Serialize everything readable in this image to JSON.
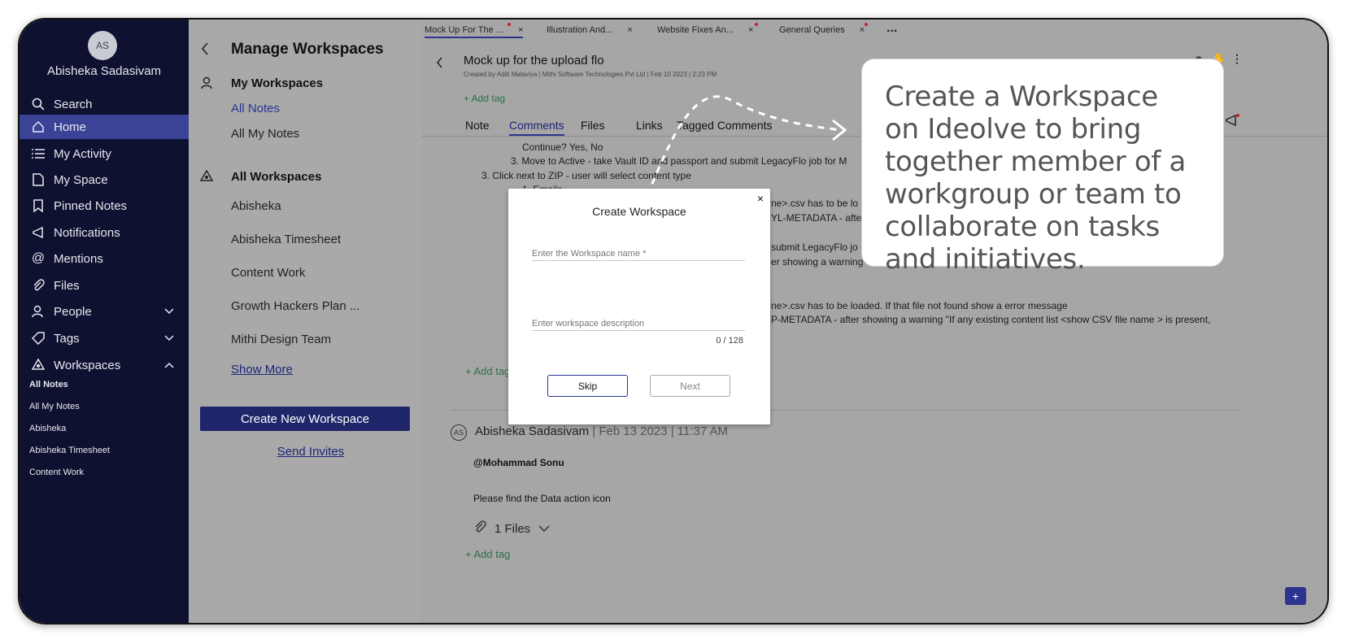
{
  "user": {
    "initials": "AS",
    "name": "Abisheka Sadasivam"
  },
  "nav": {
    "items": [
      {
        "label": "Search",
        "icon": "search-icon"
      },
      {
        "label": "Home",
        "icon": "home-icon"
      },
      {
        "label": "My Activity",
        "icon": "list-icon"
      },
      {
        "label": "My Space",
        "icon": "document-icon"
      },
      {
        "label": "Pinned Notes",
        "icon": "bookmark-icon"
      },
      {
        "label": "Notifications",
        "icon": "megaphone-icon"
      },
      {
        "label": "Mentions",
        "icon": "at-icon"
      },
      {
        "label": "Files",
        "icon": "paperclip-icon"
      },
      {
        "label": "People",
        "icon": "people-icon"
      },
      {
        "label": "Tags",
        "icon": "tag-icon"
      },
      {
        "label": "Workspaces",
        "icon": "workspaces-icon"
      }
    ],
    "workspace_subitems": [
      "All Notes",
      "All My Notes",
      "Abisheka",
      "Abisheka Timesheet",
      "Content Work"
    ]
  },
  "panel": {
    "title": "Manage Workspaces",
    "my_workspaces": "My Workspaces",
    "my_links": [
      "All Notes",
      "All My Notes"
    ],
    "all_workspaces": "All Workspaces",
    "workspaces": [
      "Abisheka",
      "Abisheka Timesheet",
      "Content Work",
      "Growth Hackers Plan ...",
      "Mithi Design Team"
    ],
    "show_more": "Show More",
    "create_button": "Create New Workspace",
    "send_invites": "Send Invites"
  },
  "tabs": [
    "Mock Up For The ...",
    "Illustration And...",
    "Website Fixes An...",
    "General Queries"
  ],
  "tabs_more": "...",
  "doc": {
    "title": "Mock up for the upload flo",
    "meta": "Created by  Aditi Malaviya  |  Mithi Software Technologies Pvt Ltd  | Feb 10 2023 | 2:23 PM",
    "add_tag": "+ Add tag",
    "subtabs": [
      "Note",
      "Comments",
      "Files",
      "Links",
      "Tagged Comments"
    ],
    "lines": [
      "Continue? Yes, No",
      "3. Move to Active - take Vault ID and passport and submit LegacyFlo job for M",
      "3. Click next to ZIP - user will select content type",
      "1. Emails",
      "ne>.csv has to be lo",
      "YL-METADATA - after",
      "submit LegacyFlo jo",
      "er showing a warning",
      "ne>.csv has to be loaded. If that file not found show a error message",
      "P-METADATA - after showing a warning \"If any existing content list <show CSV file name > is present,"
    ]
  },
  "comment": {
    "initials": "AS",
    "author": "Abisheka Sadasivam",
    "date": "| Feb 13 2023 | 11:37 AM",
    "mention": "@Mohammad Sonu",
    "body": "Please find the Data action icon",
    "files": "1 Files",
    "add_tag": "+ Add tag"
  },
  "modal": {
    "title": "Create Workspace",
    "name_placeholder": "Enter the Workspace name *",
    "desc_placeholder": "Enter workspace description",
    "counter": "0 / 128",
    "skip": "Skip",
    "next": "Next",
    "close": "×"
  },
  "callout": {
    "text": "Create a Workspace on Ideolve to bring together member of a workgroup or team to collaborate on tasks and initiatives."
  },
  "colors": {
    "nav_bg": "#0e1130",
    "accent": "#3a4396",
    "primary_button": "#1f2669"
  }
}
